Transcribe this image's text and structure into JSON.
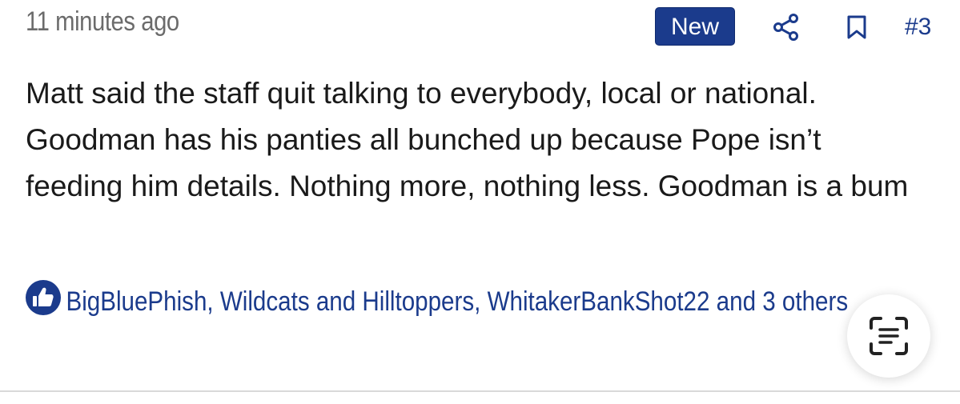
{
  "post": {
    "timestamp": "11 minutes ago",
    "badge": "New",
    "post_number": "#3",
    "body": "Matt said the staff quit talking to everybody, local or national. Goodman has his panties all bunched up because Pope isn’t feeding him details. Nothing more, nothing less. Goodman is a bum",
    "reactions": {
      "icon": "thumbs-up-icon",
      "text": "BigBluePhish, Wildcats and Hilltoppers, WhitakerBankShot22 and 3 others"
    },
    "actions": {
      "share_icon": "share-icon",
      "bookmark_icon": "bookmark-icon"
    }
  },
  "floating": {
    "scan_icon": "scan-text-icon"
  },
  "colors": {
    "accent": "#1b3b8c",
    "timestamp": "#6b6b6b",
    "body_text": "#1a1a1a",
    "divider": "#d9d9d9"
  }
}
